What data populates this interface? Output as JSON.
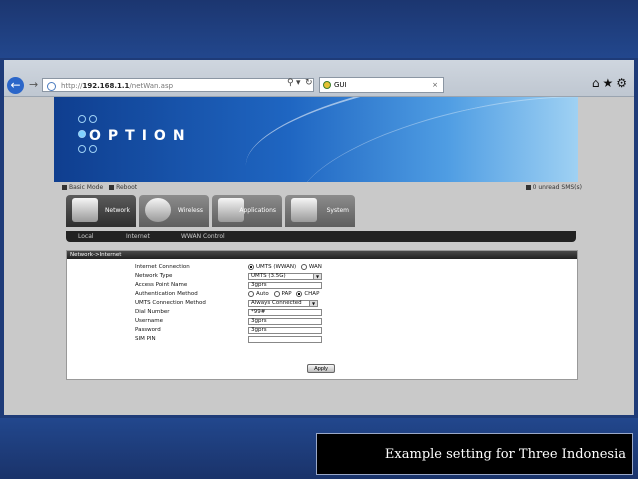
{
  "caption": "Example setting for Three Indonesia",
  "browser": {
    "url_scheme": "http://",
    "url_host": "192.168.1.1",
    "url_path": "/netWan.asp",
    "tab_title": "GUI",
    "tab_close": "×"
  },
  "banner": {
    "logo": "OPTION"
  },
  "status": {
    "basic_mode": "Basic Mode",
    "reboot": "Reboot",
    "unread_sms": "0 unread SMS(s)"
  },
  "nav": {
    "tabs": [
      {
        "label": "Network"
      },
      {
        "label": "Wireless"
      },
      {
        "label": "Applications"
      },
      {
        "label": "System"
      }
    ],
    "subnav": [
      "Local",
      "Internet",
      "WWAN Control"
    ]
  },
  "panel": {
    "title": "Network->Internet",
    "internet_connection": {
      "label": "Internet Connection",
      "option1": "UMTS (WWAN)",
      "option2": "WAN",
      "selected": "UMTS (WWAN)"
    },
    "network_type": {
      "label": "Network Type",
      "value": "UMTS (3.5G)"
    },
    "apn": {
      "label": "Access Point Name",
      "value": "3gprs"
    },
    "auth_method": {
      "label": "Authentication Method",
      "option1": "Auto",
      "option2": "PAP",
      "option3": "CHAP",
      "selected": "CHAP"
    },
    "conn_method": {
      "label": "UMTS Connection Method",
      "value": "Always Connected"
    },
    "dial_number": {
      "label": "Dial Number",
      "value": "*99#"
    },
    "username": {
      "label": "Username",
      "value": "3gprs"
    },
    "password": {
      "label": "Password",
      "value": "3gprs"
    },
    "sim_pin": {
      "label": "SIM PIN",
      "value": ""
    },
    "apply_label": "Apply"
  }
}
